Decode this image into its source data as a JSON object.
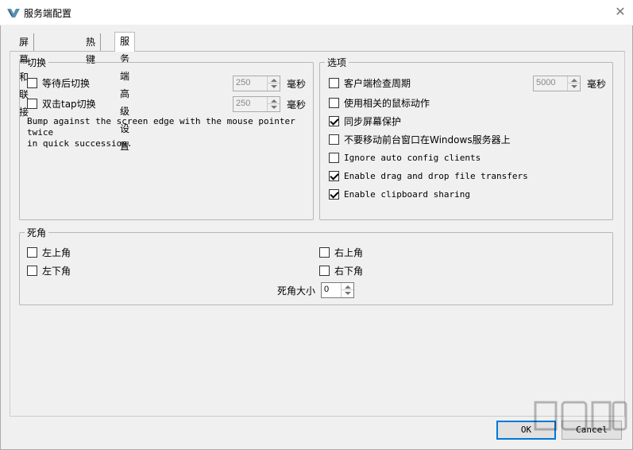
{
  "window": {
    "title": "服务端配置",
    "close_glyph": "✕"
  },
  "tabs": [
    {
      "label": "屏幕和联接"
    },
    {
      "label": "热键"
    },
    {
      "label": "服务端高级设置"
    }
  ],
  "switch_group": {
    "legend": "切换",
    "wait_switch": {
      "label": "等待后切换",
      "checked": false,
      "value": "250",
      "unit": "毫秒"
    },
    "double_tap": {
      "label": "双击tap切换",
      "checked": false,
      "value": "250",
      "unit": "毫秒"
    },
    "description_line1": "Bump against the screen edge with the mouse pointer twice",
    "description_line2": "in quick succession."
  },
  "options_group": {
    "legend": "选项",
    "heartbeat": {
      "label": "客户端检查周期",
      "checked": false,
      "value": "5000",
      "unit": "毫秒"
    },
    "relative_mouse": {
      "label": "使用相关的鼠标动作",
      "checked": false
    },
    "screensaver_sync": {
      "label": "同步屏幕保护",
      "checked": true
    },
    "win_foreground": {
      "label": "不要移动前台窗口在Windows服务器上",
      "checked": false
    },
    "ignore_auto_config": {
      "label": "Ignore auto config clients",
      "checked": false
    },
    "drag_drop": {
      "label": "Enable drag and drop file transfers",
      "checked": true
    },
    "clipboard": {
      "label": "Enable clipboard sharing",
      "checked": true
    }
  },
  "dead_corners": {
    "legend": "死角",
    "top_left": {
      "label": "左上角",
      "checked": false
    },
    "bottom_left": {
      "label": "左下角",
      "checked": false
    },
    "top_right": {
      "label": "右上角",
      "checked": false
    },
    "bottom_right": {
      "label": "右下角",
      "checked": false
    },
    "size_label": "死角大小",
    "size_value": "0"
  },
  "buttons": {
    "ok": "OK",
    "cancel": "Cancel"
  }
}
